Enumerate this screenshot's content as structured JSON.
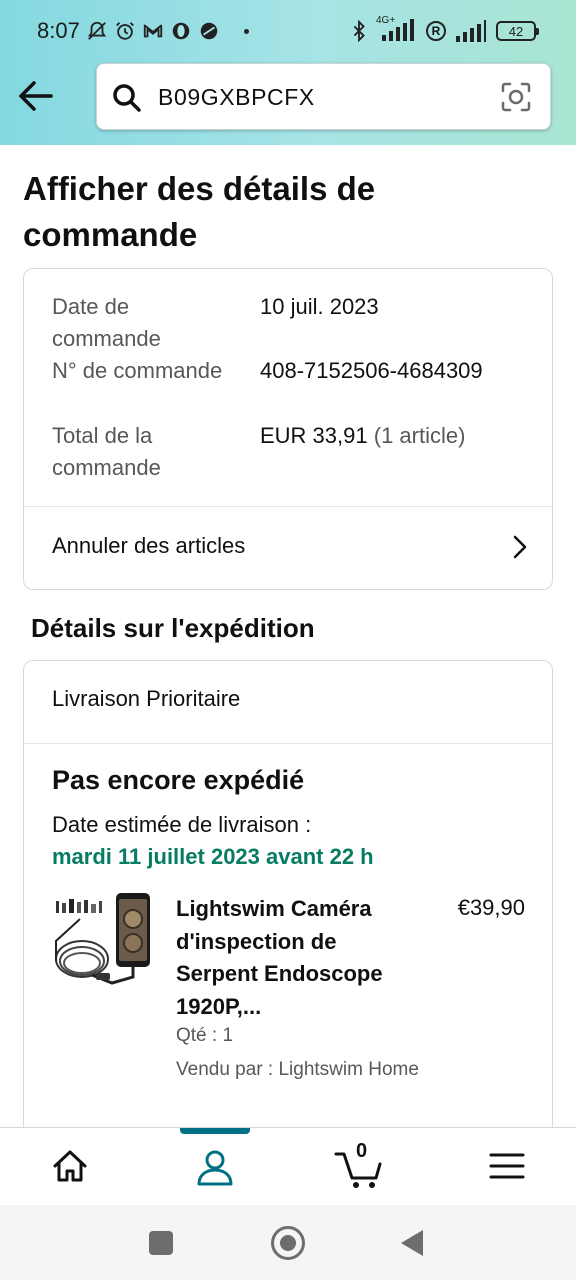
{
  "status_bar": {
    "time": "8:07",
    "network_label": "4G+",
    "battery": "42"
  },
  "search": {
    "value": "B09GXBPCFX"
  },
  "page": {
    "title": "Afficher des détails de commande"
  },
  "order_summary": {
    "rows": [
      {
        "label": "Date de commande",
        "value": "10 juil. 2023"
      },
      {
        "label": "N° de commande",
        "value": "408-7152506-4684309"
      },
      {
        "label": "Total de la commande",
        "value": "EUR 33,91",
        "note": "(1 article)"
      }
    ],
    "cancel_label": "Annuler des articles"
  },
  "shipment": {
    "section_title": "Détails sur l'expédition",
    "method": "Livraison Prioritaire",
    "status": "Pas encore expédié",
    "estimate_label": "Date estimée de livraison :",
    "estimate_date": "mardi 11 juillet 2023 avant 22 h",
    "estimate_color": "#067d62",
    "item": {
      "title": "Lightswim Caméra d'inspection de Serpent Endoscope 1920P,...",
      "price": "€39,90",
      "qty": "Qté : 1",
      "seller": "Vendu par : Lightswim Home"
    }
  },
  "tabbar": {
    "active": "account",
    "accent_color": "#007185",
    "cart_count": "0",
    "tabs": [
      "home-icon",
      "account-icon",
      "cart-icon",
      "menu-icon"
    ]
  }
}
